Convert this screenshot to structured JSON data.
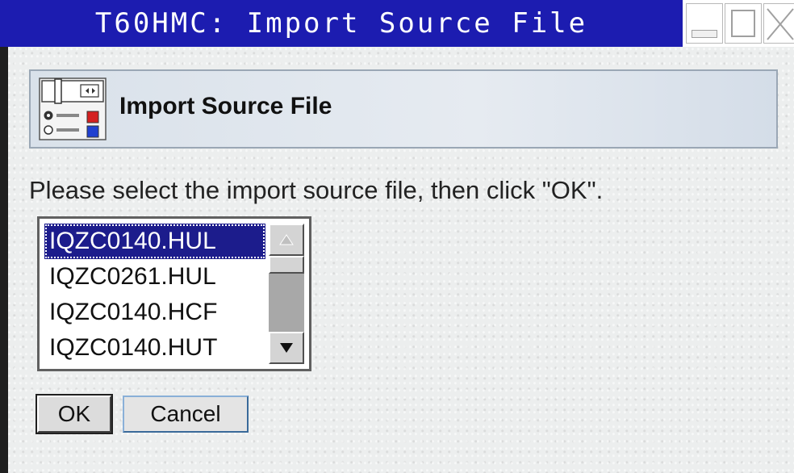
{
  "window": {
    "title": "T60HMC: Import Source File",
    "controls": [
      "minimize-icon",
      "maximize-icon",
      "close-icon"
    ]
  },
  "header": {
    "title": "Import Source File",
    "icon": "control-panel-icon"
  },
  "instruction": "Please select the import source file, then click \"OK\".",
  "file_list": {
    "items": [
      "IQZC0140.HUL",
      "IQZC0261.HUL",
      "IQZC0140.HCF",
      "IQZC0140.HUT"
    ],
    "selected_index": 0
  },
  "buttons": {
    "ok_label": "OK",
    "cancel_label": "Cancel"
  },
  "colors": {
    "title_bar": "#1c1cb0",
    "selection": "#1c1c8c"
  }
}
